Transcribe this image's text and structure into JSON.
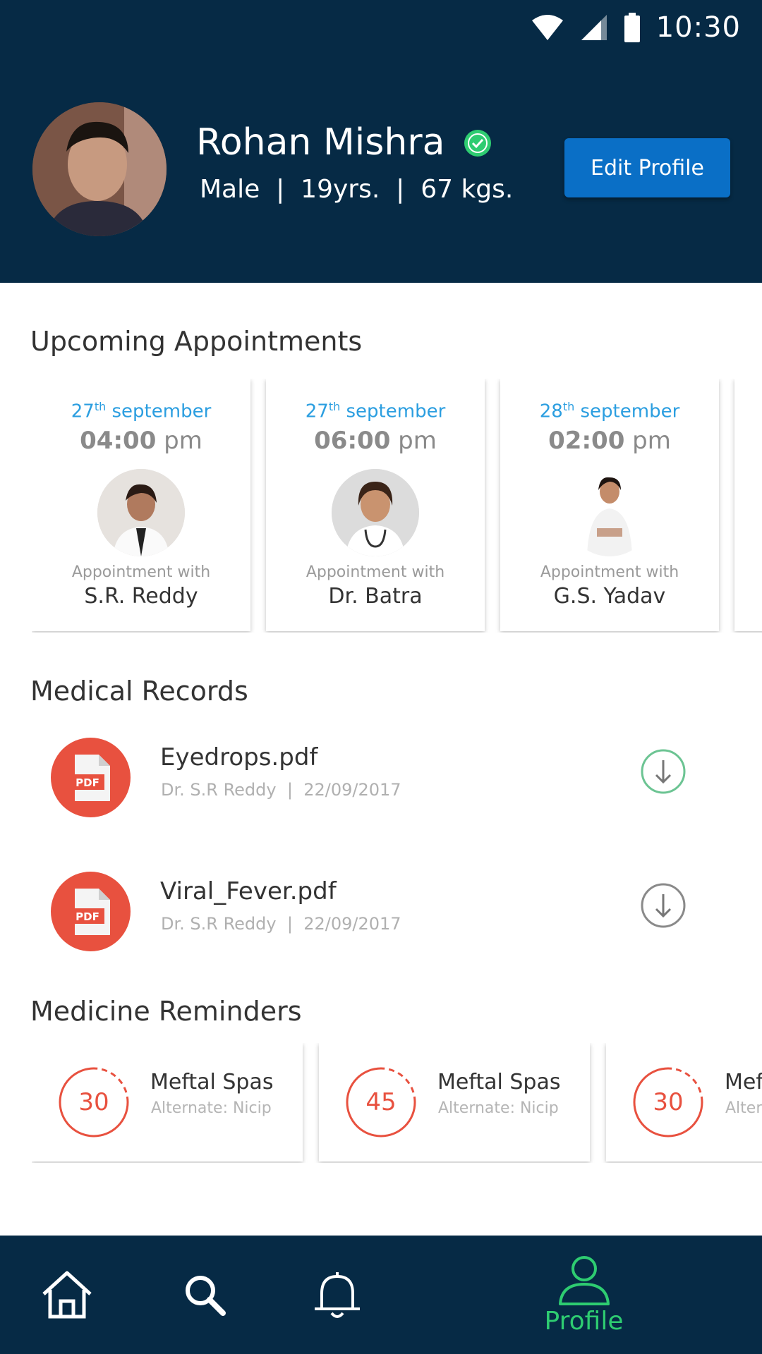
{
  "status_bar": {
    "time": "10:30"
  },
  "profile": {
    "name": "Rohan Mishra",
    "meta": "Male  |  19yrs.  |  67 kgs.",
    "edit_button": "Edit Profile"
  },
  "appointments": {
    "title": "Upcoming Appointments",
    "items": [
      {
        "day": "27",
        "suffix": "th",
        "month": "september",
        "time": "04:00",
        "ampm": "pm",
        "with_label": "Appointment with",
        "doctor": "S.R. Reddy"
      },
      {
        "day": "27",
        "suffix": "th",
        "month": "september",
        "time": "06:00",
        "ampm": "pm",
        "with_label": "Appointment with",
        "doctor": "Dr. Batra"
      },
      {
        "day": "28",
        "suffix": "th",
        "month": "september",
        "time": "02:00",
        "ampm": "pm",
        "with_label": "Appointment with",
        "doctor": "G.S. Yadav"
      }
    ]
  },
  "records": {
    "title": "Medical Records",
    "items": [
      {
        "icon_label": "PDF",
        "name": "Eyedrops.pdf",
        "meta": "Dr. S.R Reddy  |  22/09/2017",
        "downloaded": true
      },
      {
        "icon_label": "PDF",
        "name": "Viral_Fever.pdf",
        "meta": "Dr. S.R Reddy  |  22/09/2017",
        "downloaded": false
      }
    ]
  },
  "reminders": {
    "title": "Medicine Reminders",
    "items": [
      {
        "count": "30",
        "name": "Meftal Spas",
        "alternate": "Alternate: Nicip"
      },
      {
        "count": "45",
        "name": "Meftal Spas",
        "alternate": "Alternate: Nicip"
      },
      {
        "count": "30",
        "name": "Meftal Spas",
        "alternate": "Alternate: Nicip"
      }
    ]
  },
  "bottom_nav": {
    "home_icon": "home-icon",
    "search_icon": "search-icon",
    "bell_icon": "bell-icon",
    "profile_icon": "person-icon",
    "profile_label": "Profile"
  },
  "colors": {
    "header": "#062a45",
    "accent_blue": "#0a6fc6",
    "date_blue": "#2b9ee0",
    "pdf_red": "#e8513f",
    "active_green": "#2ecc71"
  }
}
